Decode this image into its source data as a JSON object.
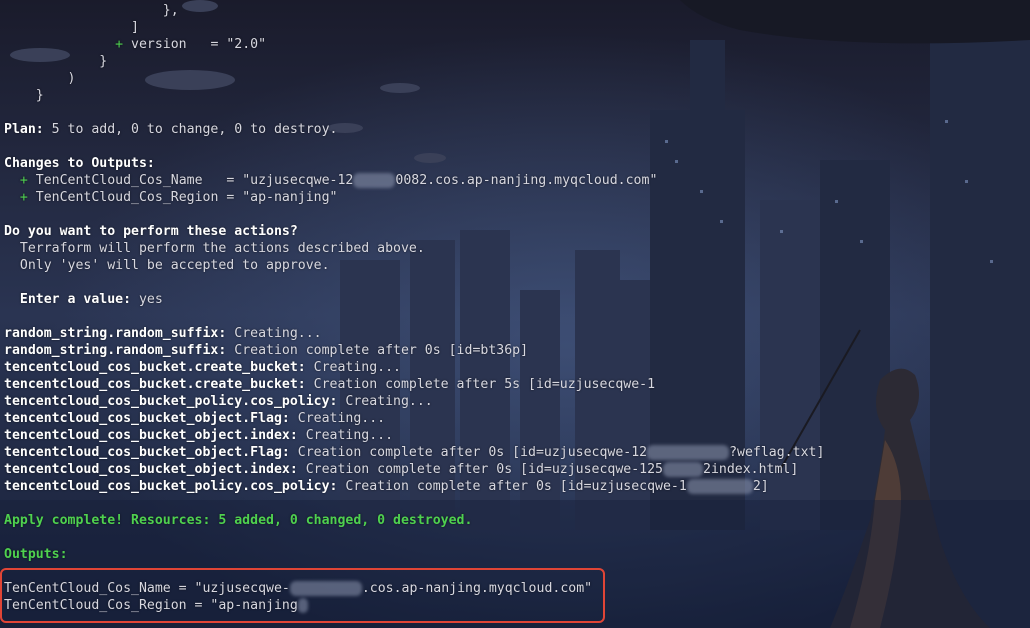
{
  "code_tail": {
    "close_brace_comma": "},",
    "close_bracket": "]",
    "version_plus": "+",
    "version_line": " version   = \"2.0\"",
    "close_brace": "}",
    "close_paren": ")",
    "close_brace_outer": "}"
  },
  "plan": {
    "label": "Plan:",
    "text": " 5 to add, 0 to change, 0 to destroy."
  },
  "changes": {
    "heading": "Changes to Outputs:",
    "name_plus": "+",
    "name_text": " TenCentCloud_Cos_Name   = \"uzjusecqwe-12",
    "name_suffix": "0082.cos.ap-nanjing.myqcloud.com\"",
    "region_plus": "+",
    "region_text": " TenCentCloud_Cos_Region = \"ap-nanjing\""
  },
  "prompt": {
    "question": "Do you want to perform these actions?",
    "desc1": "  Terraform will perform the actions described above.",
    "desc2": "  Only 'yes' will be accepted to approve.",
    "enter_label": "  Enter a value:",
    "enter_value": " yes"
  },
  "log": [
    {
      "res": "random_string.random_suffix:",
      "msg": " Creating..."
    },
    {
      "res": "random_string.random_suffix:",
      "msg": " Creation complete after 0s [id=bt36p]"
    },
    {
      "res": "tencentcloud_cos_bucket.create_bucket:",
      "msg": " Creating..."
    },
    {
      "res": "tencentcloud_cos_bucket.create_bucket:",
      "msg": " Creation complete after 5s [id=uzjusecqwe-1"
    },
    {
      "res": "tencentcloud_cos_bucket_policy.cos_policy:",
      "msg": " Creating..."
    },
    {
      "res": "tencentcloud_cos_bucket_object.Flag:",
      "msg": " Creating..."
    },
    {
      "res": "tencentcloud_cos_bucket_object.index:",
      "msg": " Creating..."
    },
    {
      "res": "tencentcloud_cos_bucket_object.Flag:",
      "msg": " Creation complete after 0s [id=uzjusecqwe-12",
      "tail": "?weflag.txt]"
    },
    {
      "res": "tencentcloud_cos_bucket_object.index:",
      "msg": " Creation complete after 0s [id=uzjusecqwe-125",
      "tail": "2index.html]"
    },
    {
      "res": "tencentcloud_cos_bucket_policy.cos_policy:",
      "msg": " Creation complete after 0s [id=uzjusecqwe-1",
      "tail": "2]"
    }
  ],
  "apply": "Apply complete! Resources: 5 added, 0 changed, 0 destroyed.",
  "outputs": {
    "heading": "Outputs:",
    "name_text": "TenCentCloud_Cos_Name = \"uzjusecqwe-",
    "name_suffix": ".cos.ap-nanjing.myqcloud.com\"",
    "region_text": "TenCentCloud_Cos_Region = \"ap-nanjing"
  },
  "colors": {
    "success": "#4fd14f",
    "highlight_border": "#e04536"
  }
}
